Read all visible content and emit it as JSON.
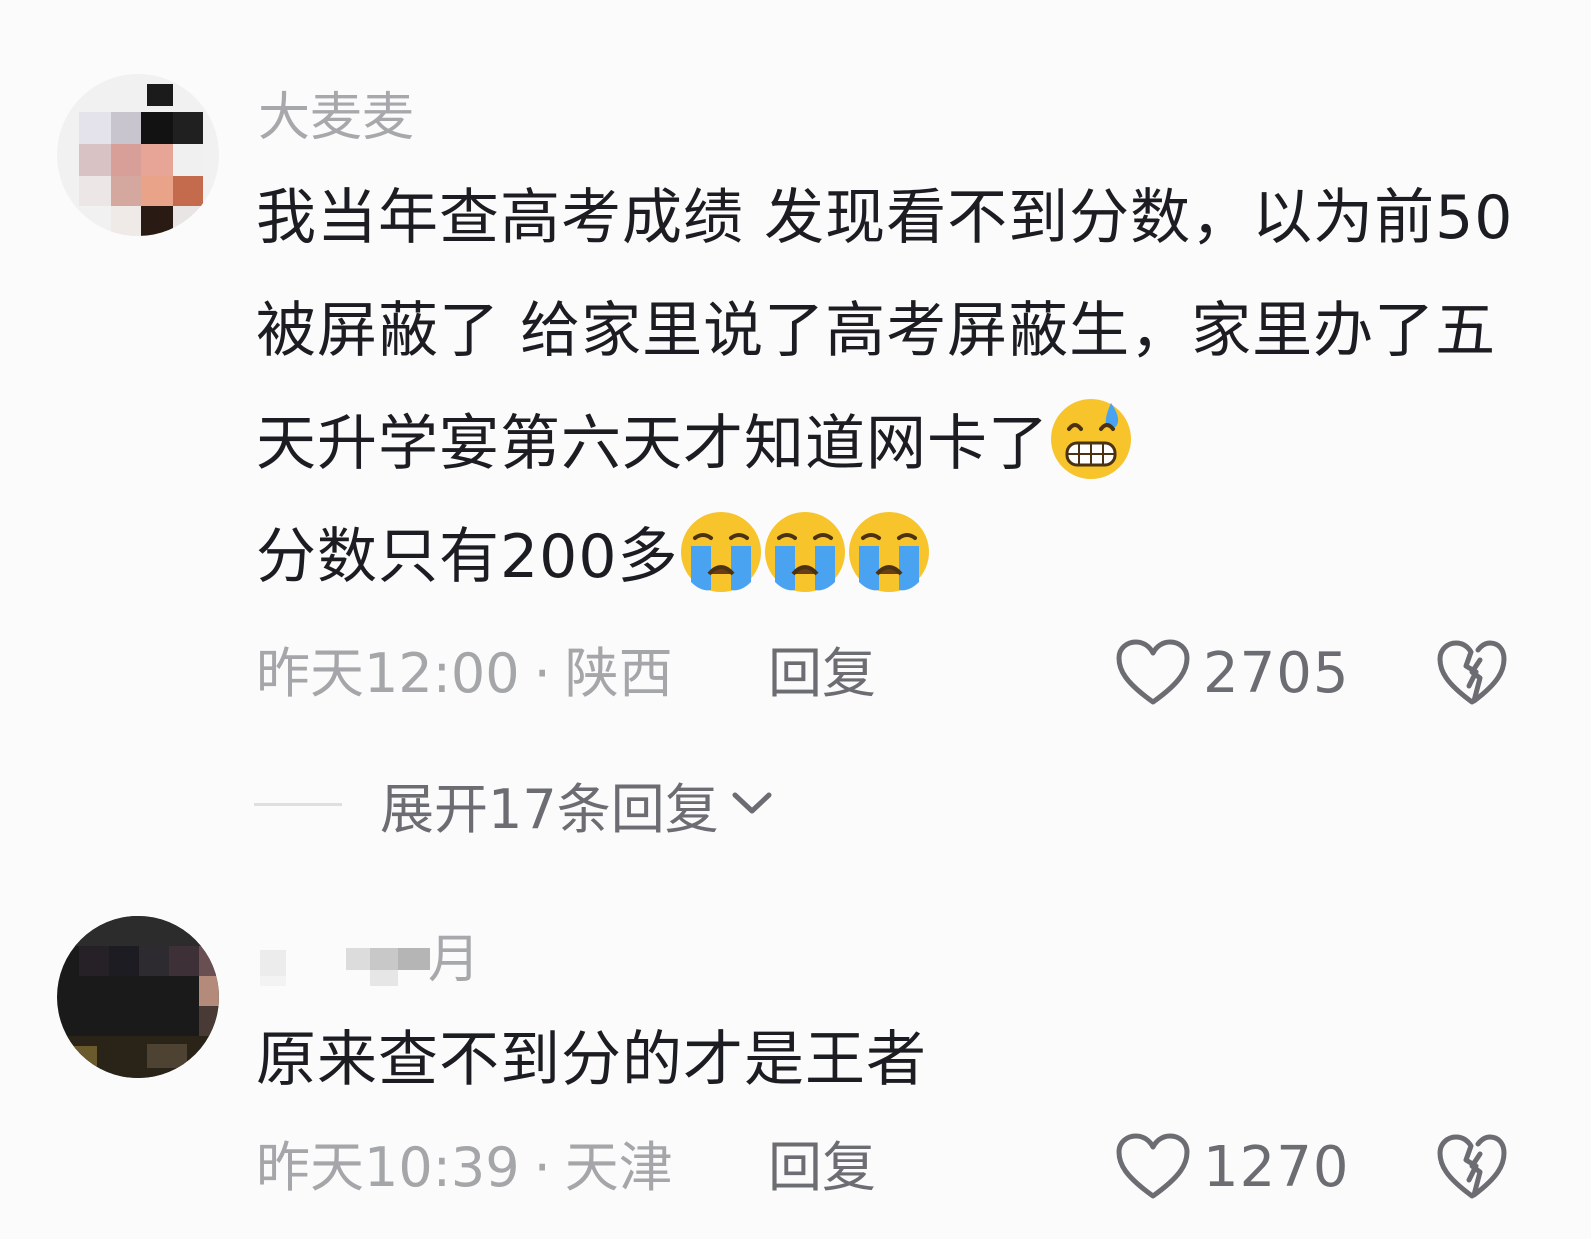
{
  "comments": [
    {
      "username": "大麦麦",
      "text_parts": [
        "我当年查高考成绩 发现看不到分数，以为前50被屏蔽了 给家里说了高考屏蔽生，家里办了五天升学宴第六天才知道网卡了",
        "分数只有200多"
      ],
      "emojis": [
        "grimacing-sweat-emoji",
        "loudly-crying-emoji",
        "loudly-crying-emoji",
        "loudly-crying-emoji"
      ],
      "time": "昨天12:00",
      "location": "陕西",
      "reply_label": "回复",
      "like_count": "2705",
      "expand_label": "展开17条回复"
    },
    {
      "username": "月",
      "text": "原来查不到分的才是王者",
      "time": "昨天10:39",
      "location": "天津",
      "reply_label": "回复",
      "like_count": "1270"
    }
  ],
  "separator": "·",
  "colors": {
    "background": "#fbfbfb",
    "primary_text": "#1c1d22",
    "secondary_text": "#a5a6a9",
    "action_text": "#6c6d72",
    "emoji_yellow": "#f7c42b",
    "emoji_tear_blue": "#4aa3f0"
  }
}
